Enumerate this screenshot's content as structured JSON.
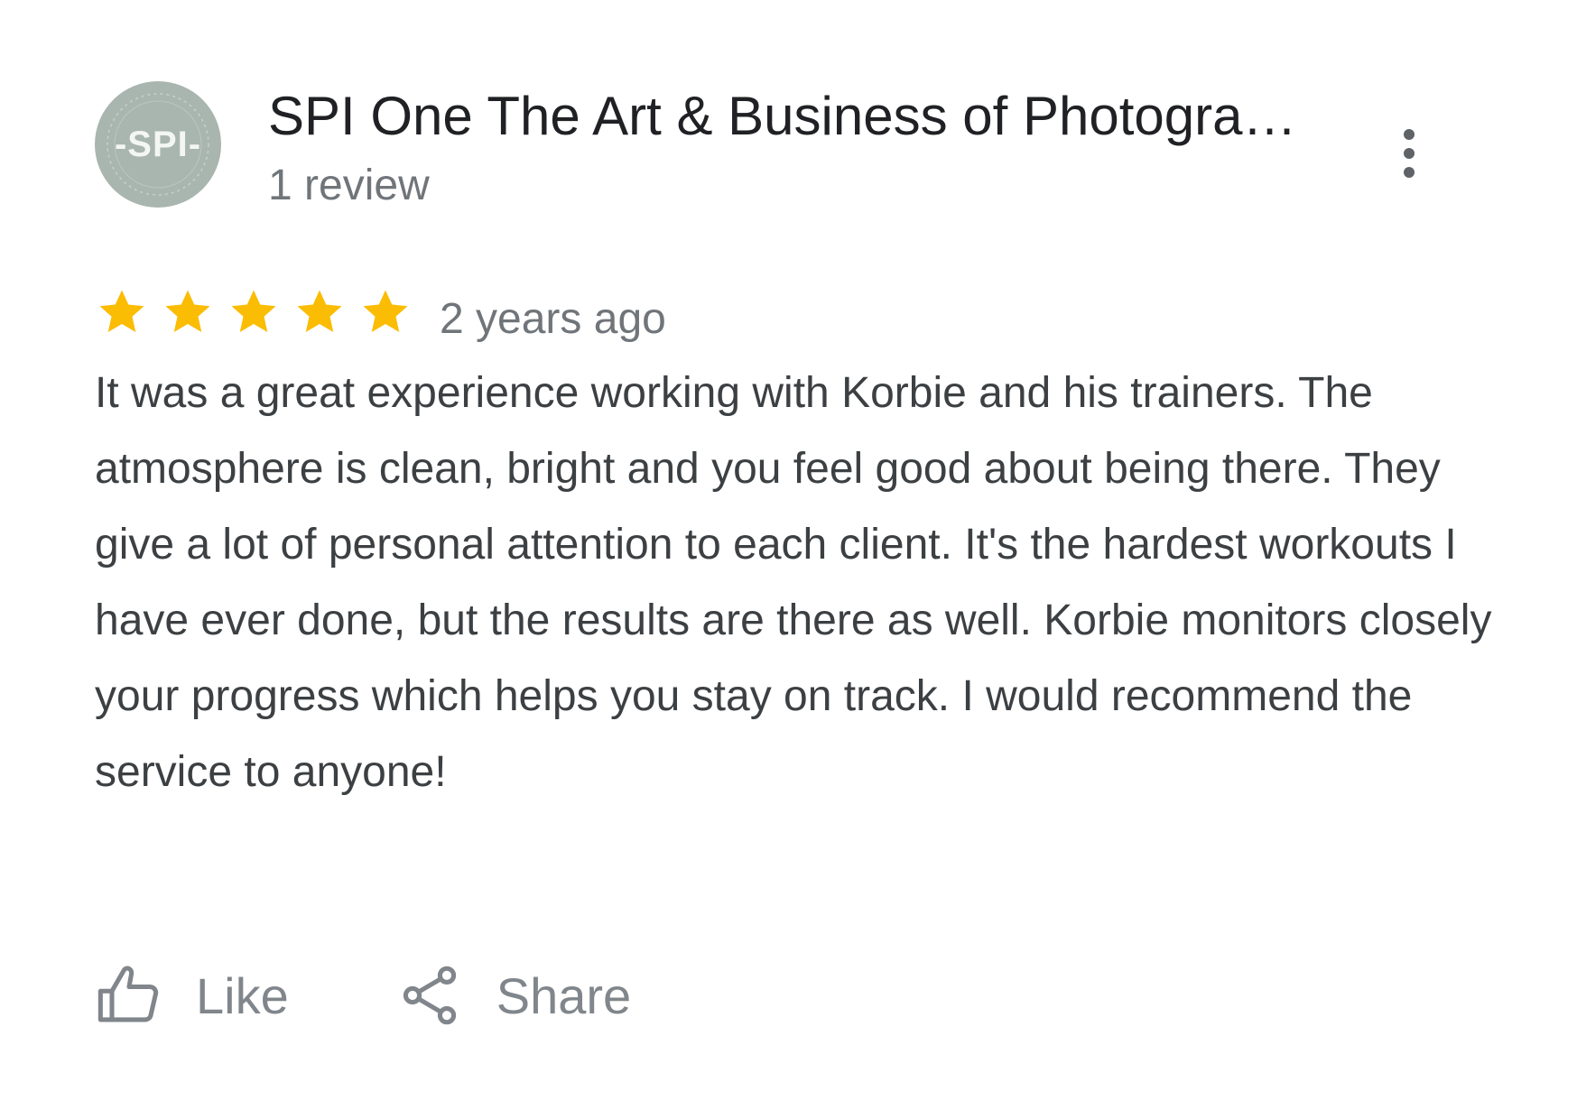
{
  "reviewer": {
    "avatar_text": "-SPI-",
    "name": "SPI One The Art & Business of Photograp...",
    "review_count": "1 review"
  },
  "review": {
    "rating": 5,
    "rating_max": 5,
    "time_ago": "2 years ago",
    "text": "It was a great experience working with Korbie and his trainers. The atmosphere is clean, bright and you feel good about being there. They give a lot of personal attention to each client. It's the hardest workouts I have ever done, but the results are there as well. Korbie monitors closely your progress which helps you stay on track. I would recommend the service to anyone!"
  },
  "actions": {
    "like_label": "Like",
    "share_label": "Share"
  },
  "icons": {
    "more": "more-vert-icon",
    "star": "star-icon",
    "like": "thumb-up-icon",
    "share": "share-icon"
  },
  "colors": {
    "star": "#FBBC04",
    "name": "#202124",
    "secondary_text": "#70757A",
    "body_text": "#3C4043",
    "action_text": "#80868B",
    "avatar_bg": "#A9B5AF"
  }
}
